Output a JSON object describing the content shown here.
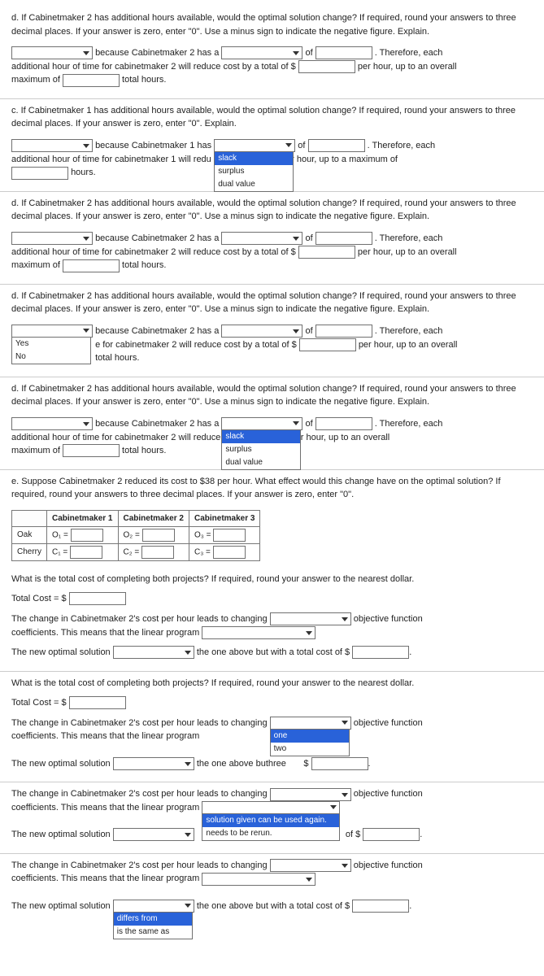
{
  "q_d1": {
    "prompt": "d. If Cabinetmaker 2 has additional hours available, would the optimal solution change? If required, round your answers to three decimal places. If your answer is zero, enter \"0\". Use a minus sign to indicate the negative figure. Explain.",
    "t1": "because Cabinetmaker 2 has a",
    "t2": "of",
    "t3": ". Therefore, each",
    "t4": "additional hour of time for cabinetmaker 2 will reduce cost by a total of $",
    "t5": "per hour, up to an overall",
    "t6": "maximum of",
    "t7": "total hours."
  },
  "q_c": {
    "prompt": "c. If Cabinetmaker 1 has additional hours available, would the optimal solution change? If required, round your answers to three decimal places. If your answer is zero, enter \"0\". Explain.",
    "t1": "because Cabinetmaker 1 has",
    "t2": "of",
    "t3": ". Therefore, each",
    "t4": "additional hour of time for cabinetmaker 1 will redu",
    "t5": "per hour, up to a maximum of",
    "t6": "hours.",
    "opts": [
      "slack",
      "surplus",
      "dual value"
    ]
  },
  "q_d2": {
    "prompt": "d. If Cabinetmaker 2 has additional hours available, would the optimal solution change? If required, round your answers to three decimal places. If your answer is zero, enter \"0\". Use a minus sign to indicate the negative figure. Explain.",
    "t1": "because Cabinetmaker 2 has a",
    "t2": "of",
    "t3": ". Therefore, each",
    "t4": "additional hour of time for cabinetmaker 2 will reduce cost by a total of $",
    "t5": "per hour, up to an overall",
    "t6": "maximum of",
    "t7": "total hours."
  },
  "q_d3": {
    "prompt": "d. If Cabinetmaker 2 has additional hours available, would the optimal solution change? If required, round your answers to three decimal places. If your answer is zero, enter \"0\". Use a minus sign to indicate the negative figure. Explain.",
    "t1": "because Cabinetmaker 2 has a",
    "t2": "of",
    "t3": ". Therefore, each",
    "t4": "e for cabinetmaker 2 will reduce cost by a total of $",
    "t5": "per hour, up to an overall",
    "t7": "total hours.",
    "opts": [
      "Yes",
      "No"
    ]
  },
  "q_d4": {
    "prompt": "d. If Cabinetmaker 2 has additional hours available, would the optimal solution change? If required, round your answers to three decimal places. If your answer is zero, enter \"0\". Use a minus sign to indicate the negative figure. Explain.",
    "t1": "because Cabinetmaker 2 has a",
    "t2": "of",
    "t3": ". Therefore, each",
    "t4": "additional hour of time for cabinetmaker 2 will reduce",
    "t5": "per hour, up to an overall",
    "t6": "maximum of",
    "t7": "total hours.",
    "opts": [
      "slack",
      "surplus",
      "dual value"
    ]
  },
  "q_e": {
    "prompt": "e. Suppose Cabinetmaker 2 reduced its cost to $38 per hour. What effect would this change have on the optimal solution? If required, round your answers to three decimal places. If your answer is zero, enter \"0\".",
    "headers": [
      "",
      "Cabinetmaker 1",
      "Cabinetmaker 2",
      "Cabinetmaker 3"
    ],
    "rows": [
      {
        "label": "Oak",
        "cells": [
          "O₁ =",
          "O₂ =",
          "O₃ ="
        ]
      },
      {
        "label": "Cherry",
        "cells": [
          "C₁ =",
          "C₂ =",
          "C₃ ="
        ]
      }
    ],
    "totq": "What is the total cost of completing both projects? If required, round your answer to the nearest dollar.",
    "totlabel": "Total Cost = $",
    "chg1": "The change in Cabinetmaker 2's cost per hour leads to changing",
    "chg2": "objective function",
    "chg3": "coefficients. This means that the linear program",
    "new1": "The new optimal solution",
    "new2": "the one above but with a total cost of $"
  },
  "block2": {
    "totq": "What is the total cost of completing both projects? If required, round your answer to the nearest dollar.",
    "totlabel": "Total Cost = $",
    "chg1": "The change in Cabinetmaker 2's cost per hour leads to changing",
    "chg2": "objective function",
    "chg3": "coefficients. This means that the linear program",
    "new1": "The new optimal solution",
    "new2a": "the one above bu",
    "new2b": "three",
    "opts": [
      "one",
      "two"
    ],
    "dollar": "$"
  },
  "block3": {
    "chg1": "The change in Cabinetmaker 2's cost per hour leads to changing",
    "chg2": "objective function",
    "chg3": "coefficients. This means that the linear program",
    "new1": "The new optimal solution",
    "opts": [
      "solution given can be used again.",
      "needs to be rerun."
    ],
    "trail": "of $"
  },
  "block4": {
    "chg1": "The change in Cabinetmaker 2's cost per hour leads to changing",
    "chg2": "objective function",
    "chg3": "coefficients. This means that the linear program",
    "new1": "The new optimal solution",
    "new2": "the one above but with a total cost of $",
    "opts": [
      "differs from",
      "is the same as"
    ]
  }
}
